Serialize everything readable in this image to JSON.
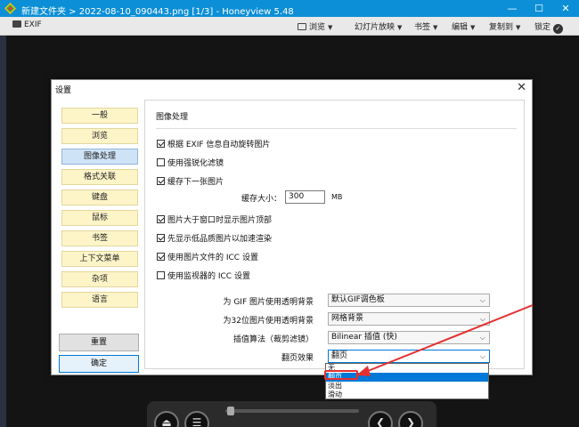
{
  "titlebar": {
    "title": "新建文件夹 > 2022-08-10_090443.png [1/3] - Honeyview 5.48",
    "minimize": "—",
    "maximize": "☐",
    "close": "✕"
  },
  "toolbar": {
    "exif": "EXIF",
    "items": [
      "浏览",
      "幻灯片放映",
      "书签",
      "编辑",
      "复制到",
      "锁定"
    ]
  },
  "dialog": {
    "title": "设置",
    "close": "✕",
    "nav": [
      "一般",
      "浏览",
      "图像处理",
      "格式关联",
      "键盘",
      "鼠标",
      "书签",
      "上下文菜单",
      "杂项",
      "语言"
    ],
    "active_nav": "图像处理",
    "reset_button": "重置",
    "ok_button": "确定",
    "section_title": "图像处理",
    "checkboxes": [
      {
        "label": "根据 EXIF 信息自动旋转图片",
        "checked": true
      },
      {
        "label": "使用强锐化滤镜",
        "checked": false
      },
      {
        "label": "缓存下一张图片",
        "checked": true
      },
      {
        "label": "图片大于窗口时显示图片顶部",
        "checked": true
      },
      {
        "label": "先显示低品质图片以加速渲染",
        "checked": true
      },
      {
        "label": "使用图片文件的 ICC 设置",
        "checked": true
      },
      {
        "label": "使用监视器的 ICC 设置",
        "checked": false
      }
    ],
    "cache_size": {
      "label": "缓存大小：",
      "value": "300",
      "unit": "MB"
    },
    "selects": [
      {
        "label": "为 GIF 图片使用透明背景",
        "value": "默认GIF调色板"
      },
      {
        "label": "为32位图片使用透明背景",
        "value": "网格背景"
      },
      {
        "label": "插值算法（裁剪滤镜）",
        "value": "Bilinear 插值 (快)"
      },
      {
        "label": "翻页效果",
        "value": "翻页"
      }
    ],
    "dropdown_options": [
      "无",
      "翻页",
      "淡出",
      "滑动"
    ],
    "dropdown_highlighted": "翻页"
  },
  "colors": {
    "titlebar": "#0c8fd6",
    "annotation": "#e53030",
    "highlight": "#0078d7"
  }
}
